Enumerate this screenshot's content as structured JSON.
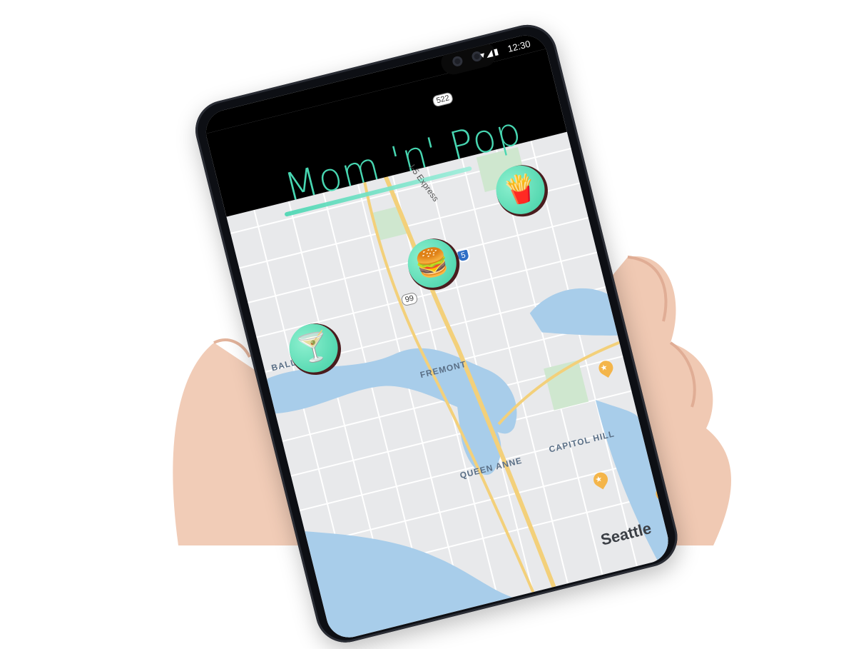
{
  "status_bar": {
    "time": "12:30",
    "icons": "▾◢▮"
  },
  "app": {
    "title": "Mom 'n' Pop"
  },
  "map": {
    "neighborhoods": [
      "BALLA",
      "FREMONT",
      "QUEEN ANNE",
      "CAPITOL HILL"
    ],
    "city": "Seattle",
    "route_shields": [
      "522",
      "99"
    ],
    "interstate": "5",
    "express_label": "I-5 Express"
  },
  "pins": [
    {
      "name": "cocktail-pin",
      "icon": "🍸"
    },
    {
      "name": "burger-pin",
      "icon": "🍔"
    },
    {
      "name": "combo-meal-pin",
      "icon": "🍟"
    }
  ],
  "colors": {
    "accent": "#47d6b1",
    "water": "#a8cdea",
    "park": "#cfe7cf",
    "highway": "#f3d07a",
    "pin_shadow": "#4a1c1e",
    "poi": "#f4b54a"
  }
}
